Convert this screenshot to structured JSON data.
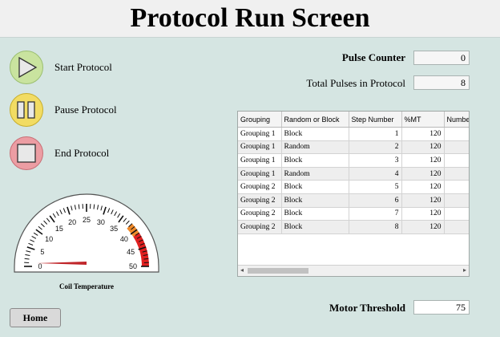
{
  "title": "Protocol Run Screen",
  "controls": {
    "start_label": "Start Protocol",
    "pause_label": "Pause Protocol",
    "end_label": "End Protocol"
  },
  "colors": {
    "start": "#c9e39f",
    "pause": "#f2dc63",
    "end": "#ec9da3",
    "gauge_needle": "#c0262a",
    "gauge_hot": "#e02020"
  },
  "pulse_counter": {
    "label": "Pulse Counter",
    "value": "0"
  },
  "total_pulses": {
    "label": "Total Pulses in Protocol",
    "value": "8"
  },
  "table": {
    "columns": [
      "Grouping",
      "Random or Block",
      "Step Number",
      "%MT",
      "Number"
    ],
    "rows": [
      [
        "Grouping 1",
        "Block",
        "1",
        "120",
        ""
      ],
      [
        "Grouping 1",
        "Random",
        "2",
        "120",
        ""
      ],
      [
        "Grouping 1",
        "Block",
        "3",
        "120",
        ""
      ],
      [
        "Grouping 1",
        "Random",
        "4",
        "120",
        ""
      ],
      [
        "Grouping 2",
        "Block",
        "5",
        "120",
        ""
      ],
      [
        "Grouping 2",
        "Block",
        "6",
        "120",
        ""
      ],
      [
        "Grouping 2",
        "Block",
        "7",
        "120",
        ""
      ],
      [
        "Grouping 2",
        "Block",
        "8",
        "120",
        ""
      ]
    ]
  },
  "gauge": {
    "caption": "Coil Temperature",
    "min": 0,
    "max": 50,
    "value": 0,
    "tick_labels": [
      "0",
      "5",
      "10",
      "15",
      "20",
      "25",
      "30",
      "35",
      "40",
      "45",
      "50"
    ],
    "warning_from": 38
  },
  "motor_threshold": {
    "label": "Motor Threshold",
    "value": "75"
  },
  "home_label": "Home"
}
